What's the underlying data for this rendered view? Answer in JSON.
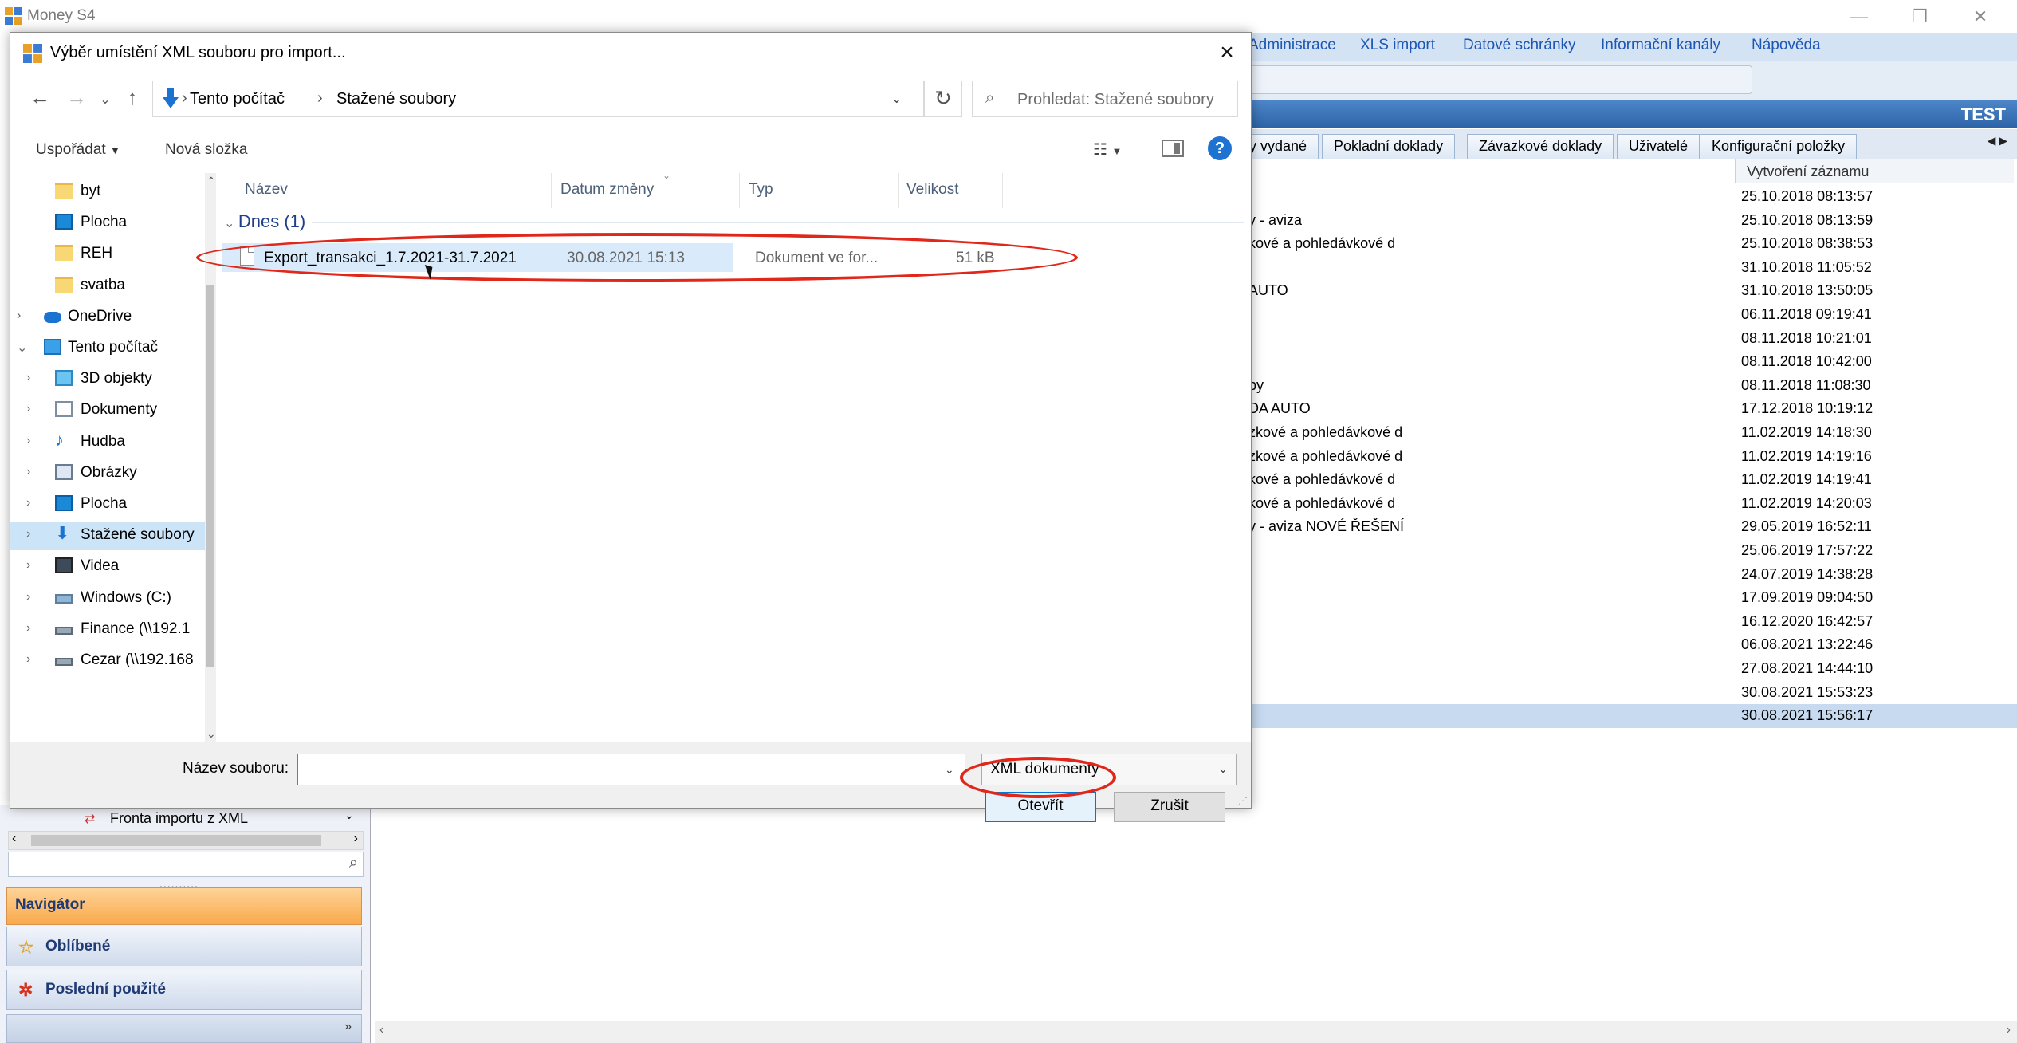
{
  "app": {
    "title": "Money S4",
    "menu": [
      "Administrace",
      "XLS import",
      "Datové schránky",
      "Informační kanály",
      "Nápověda"
    ],
    "env_label": "TEST",
    "tabs": [
      "y vydané",
      "Pokladní doklady",
      "Závazkové doklady",
      "Uživatelé",
      "Konfigurační položky"
    ],
    "grid": {
      "date_header": "Vytvoření záznamu",
      "rows": [
        {
          "name": "",
          "date": "25.10.2018 08:13:57"
        },
        {
          "name": "y - aviza",
          "date": "25.10.2018 08:13:59"
        },
        {
          "name": "kové a pohledávkové d",
          "date": "25.10.2018 08:38:53"
        },
        {
          "name": "",
          "date": "31.10.2018 11:05:52"
        },
        {
          "name": "AUTO",
          "date": "31.10.2018 13:50:05"
        },
        {
          "name": "",
          "date": "06.11.2018 09:19:41"
        },
        {
          "name": "",
          "date": "08.11.2018 10:21:01"
        },
        {
          "name": "",
          "date": "08.11.2018 10:42:00"
        },
        {
          "name": "by",
          "date": "08.11.2018 11:08:30"
        },
        {
          "name": "DA AUTO",
          "date": "17.12.2018 10:19:12"
        },
        {
          "name": "zkové a pohledávkové d",
          "date": "11.02.2019 14:18:30"
        },
        {
          "name": "zkové a pohledávkové d",
          "date": "11.02.2019 14:19:16"
        },
        {
          "name": "kové a pohledávkové d",
          "date": "11.02.2019 14:19:41"
        },
        {
          "name": "kové a pohledávkové d",
          "date": "11.02.2019 14:20:03"
        },
        {
          "name": "y - aviza NOVÉ ŘEŠENÍ",
          "date": "29.05.2019 16:52:11"
        },
        {
          "name": "",
          "date": "25.06.2019 17:57:22"
        },
        {
          "name": "",
          "date": "24.07.2019 14:38:28"
        },
        {
          "name": "",
          "date": "17.09.2019 09:04:50"
        },
        {
          "name": "",
          "date": "16.12.2020 16:42:57"
        },
        {
          "name": "",
          "date": "06.08.2021 13:22:46"
        },
        {
          "name": "",
          "date": "27.08.2021 14:44:10"
        },
        {
          "name": "",
          "date": "30.08.2021 15:53:23"
        },
        {
          "name": "",
          "date": "30.08.2021 15:56:17"
        }
      ]
    },
    "left_panel": {
      "queue_label": "Fronta importu z XML",
      "navigator": "Navigátor",
      "favorites": "Oblíbené",
      "recent": "Poslední použité"
    }
  },
  "dialog": {
    "title": "Výběr umístění XML souboru pro import...",
    "breadcrumb": [
      "Tento počítač",
      "Stažené soubory"
    ],
    "search_placeholder": "Prohledat: Stažené soubory",
    "organize": "Uspořádat",
    "new_folder": "Nová složka",
    "tree": [
      {
        "label": "byt",
        "indent": 2,
        "chev": "",
        "icon": "folder-icon",
        "selected": false
      },
      {
        "label": "Plocha",
        "indent": 2,
        "chev": "",
        "icon": "desktop-icon",
        "selected": false
      },
      {
        "label": "REH",
        "indent": 2,
        "chev": "",
        "icon": "folder-icon",
        "selected": false
      },
      {
        "label": "svatba",
        "indent": 2,
        "chev": "",
        "icon": "folder-icon",
        "selected": false
      },
      {
        "label": "OneDrive",
        "indent": 1,
        "chev": ">",
        "icon": "cloud-icon",
        "selected": false
      },
      {
        "label": "Tento počítač",
        "indent": 1,
        "chev": "v",
        "icon": "computer-icon",
        "selected": false
      },
      {
        "label": "3D objekty",
        "indent": 2,
        "chev": ">",
        "icon": "cube-icon",
        "selected": false
      },
      {
        "label": "Dokumenty",
        "indent": 2,
        "chev": ">",
        "icon": "document-icon",
        "selected": false
      },
      {
        "label": "Hudba",
        "indent": 2,
        "chev": ">",
        "icon": "music-icon",
        "selected": false
      },
      {
        "label": "Obrázky",
        "indent": 2,
        "chev": ">",
        "icon": "pictures-icon",
        "selected": false
      },
      {
        "label": "Plocha",
        "indent": 2,
        "chev": ">",
        "icon": "desktop-icon",
        "selected": false
      },
      {
        "label": "Stažené soubory",
        "indent": 2,
        "chev": ">",
        "icon": "download-icon",
        "selected": true
      },
      {
        "label": "Videa",
        "indent": 2,
        "chev": ">",
        "icon": "video-icon",
        "selected": false
      },
      {
        "label": "Windows  (C:)",
        "indent": 2,
        "chev": ">",
        "icon": "drive-icon",
        "selected": false
      },
      {
        "label": "Finance (\\\\192.1",
        "indent": 2,
        "chev": ">",
        "icon": "network-drive-icon",
        "selected": false
      },
      {
        "label": "Cezar (\\\\192.168",
        "indent": 2,
        "chev": ">",
        "icon": "network-drive-icon",
        "selected": false
      }
    ],
    "columns": {
      "name": "Název",
      "date": "Datum změny",
      "type": "Typ",
      "size": "Velikost"
    },
    "group": "Dnes (1)",
    "file": {
      "name": "Export_transakci_1.7.2021-31.7.2021",
      "date": "30.08.2021 15:13",
      "type": "Dokument ve for...",
      "size": "51 kB"
    },
    "filename_label": "Název souboru:",
    "filename_value": "",
    "filter": "XML dokumenty",
    "open": "Otevřít",
    "cancel": "Zrušit"
  },
  "colors": {
    "annotation": "#e0271a",
    "accent": "#0078d7",
    "nav_orange": "#f9a94a"
  }
}
